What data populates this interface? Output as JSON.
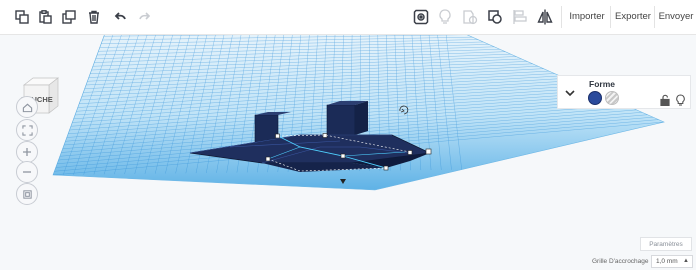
{
  "toolbar": {
    "buttons": [
      {
        "name": "copy-icon"
      },
      {
        "name": "paste-icon"
      },
      {
        "name": "duplicate-icon"
      },
      {
        "name": "trash-icon"
      },
      {
        "name": "undo-icon"
      },
      {
        "name": "redo-icon"
      }
    ],
    "right_buttons": [
      {
        "name": "show-all-icon"
      },
      {
        "name": "light-bulb-icon"
      },
      {
        "name": "group-icon"
      },
      {
        "name": "ungroup-icon"
      },
      {
        "name": "align-icon"
      },
      {
        "name": "mirror-icon"
      }
    ],
    "import_label": "Importer",
    "export_label": "Exporter",
    "send_label": "Envoyer"
  },
  "viewcube": {
    "face_label": "GAUCHE"
  },
  "nav_buttons": [
    {
      "name": "home-view-icon"
    },
    {
      "name": "fit-view-icon"
    },
    {
      "name": "zoom-in-icon"
    },
    {
      "name": "zoom-out-icon"
    },
    {
      "name": "perspective-icon"
    }
  ],
  "inspector": {
    "title": "Forme",
    "solid_color": "#2a4a9c",
    "icons": [
      "lock-icon",
      "light-bulb-icon"
    ]
  },
  "workplane": {
    "grid_color": "#2f8fd8",
    "plane_color": "#bfe3f7",
    "shape_color": "#1f2f5e"
  },
  "footer": {
    "params_label": "Paramètres",
    "snap_label": "Grille D'accrochage",
    "snap_value": "1,0 mm"
  }
}
